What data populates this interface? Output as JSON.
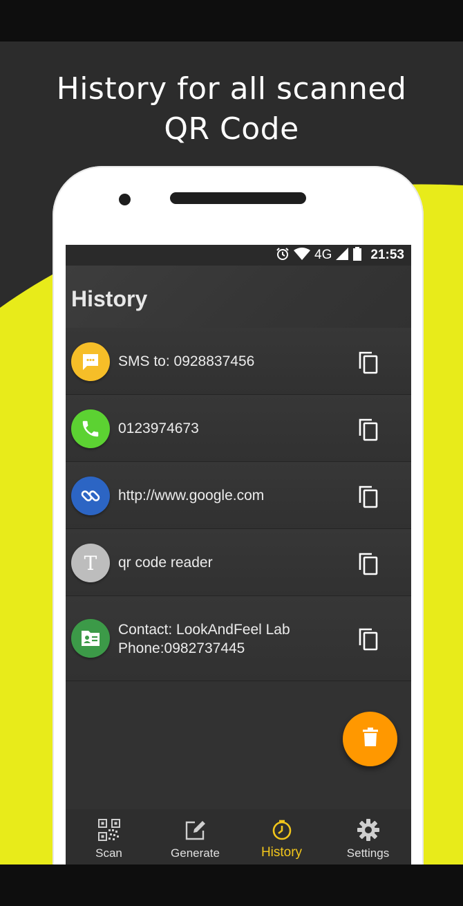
{
  "headline": {
    "line1": "History for all scanned",
    "line2": "QR Code"
  },
  "status_bar": {
    "network": "4G",
    "time": "21:53"
  },
  "app_bar": {
    "title": "History"
  },
  "history": [
    {
      "type": "sms",
      "icon": "sms-icon",
      "text": "SMS to: 0928837456",
      "color": "#f6be28"
    },
    {
      "type": "phone",
      "icon": "phone-icon",
      "text": "0123974673",
      "color": "#5cd232"
    },
    {
      "type": "url",
      "icon": "link-icon",
      "text": "http://www.google.com",
      "color": "#2c65c4"
    },
    {
      "type": "text",
      "icon": "text-icon",
      "text": "qr code reader",
      "color": "#bdbdbd"
    },
    {
      "type": "contact",
      "icon": "contact-card-icon",
      "text": "Contact:  LookAndFeel Lab\nPhone:0982737445",
      "color": "#3c9a48"
    }
  ],
  "fab": {
    "icon": "trash-icon",
    "color": "#ff9800"
  },
  "bottom_nav": [
    {
      "label": "Scan",
      "icon": "qr-icon",
      "active": false
    },
    {
      "label": "Generate",
      "icon": "edit-icon",
      "active": false
    },
    {
      "label": "History",
      "icon": "clock-icon",
      "active": true
    },
    {
      "label": "Settings",
      "icon": "gear-icon",
      "active": false
    }
  ],
  "colors": {
    "accent": "#e8eb1a",
    "active_nav": "#f2c61b",
    "background": "#2c2c2c"
  }
}
